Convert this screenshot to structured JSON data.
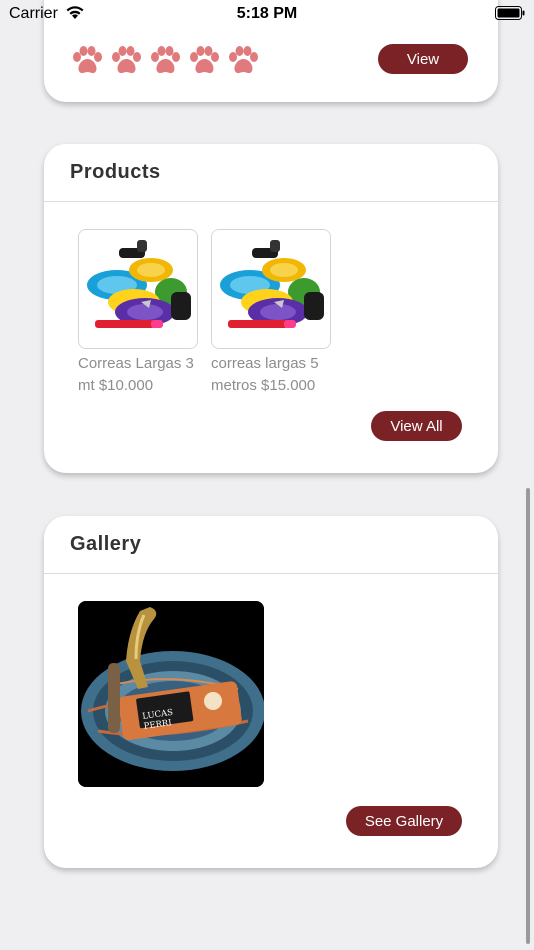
{
  "status_bar": {
    "carrier": "Carrier",
    "time": "5:18 PM"
  },
  "rating_card": {
    "rating": 5,
    "rating_max": 5,
    "paw_color": "#e07a7c",
    "view_label": "View"
  },
  "products": {
    "title": "Products",
    "items": [
      {
        "name": "Correas Largas 3 mt $10.000",
        "image": "colorful-leashes-photo"
      },
      {
        "name": "correas largas 5 metros $15.000",
        "image": "colorful-leashes-photo"
      }
    ],
    "view_all_label": "View All"
  },
  "gallery": {
    "title": "Gallery",
    "items": [
      {
        "image": "patterned-leash-photo",
        "brand_label": "LUCAS PERRI"
      }
    ],
    "see_gallery_label": "See Gallery"
  },
  "colors": {
    "accent": "#7a2226",
    "background": "#efeff1"
  }
}
